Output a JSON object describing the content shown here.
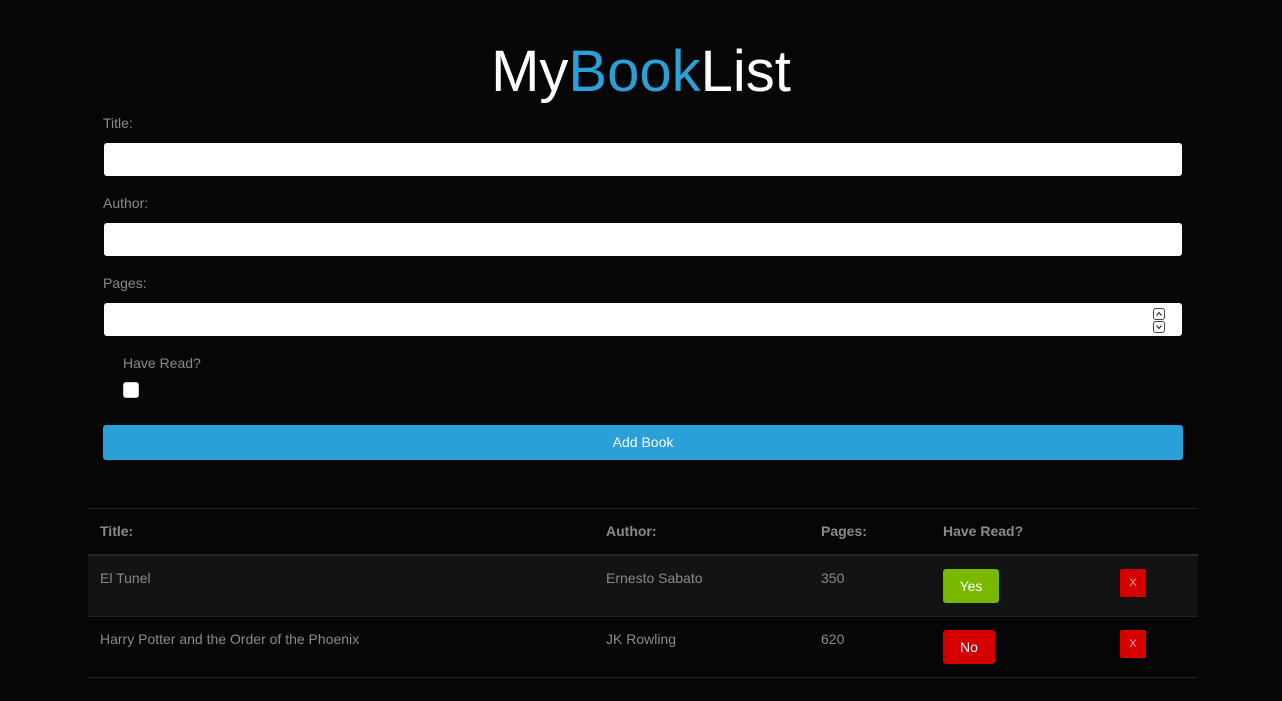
{
  "logo": {
    "part1": "My",
    "part2": "Book",
    "part3": "List"
  },
  "form": {
    "title_label": "Title:",
    "title_value": "",
    "author_label": "Author:",
    "author_value": "",
    "pages_label": "Pages:",
    "pages_value": "",
    "have_read_label": "Have Read?",
    "have_read_checked": false,
    "add_button": "Add Book"
  },
  "table": {
    "headers": [
      "Title:",
      "Author:",
      "Pages:",
      "Have Read?"
    ],
    "rows": [
      {
        "title": "El Tunel",
        "author": "Ernesto Sabato",
        "pages": "350",
        "read": "Yes",
        "delete": "X"
      },
      {
        "title": "Harry Potter and the Order of the Phoenix",
        "author": "JK Rowling",
        "pages": "620",
        "read": "No",
        "delete": "X"
      }
    ]
  },
  "colors": {
    "background": "#060606",
    "accent": "#2b9fd8",
    "yes": "#7ab800",
    "no": "#d40000"
  }
}
